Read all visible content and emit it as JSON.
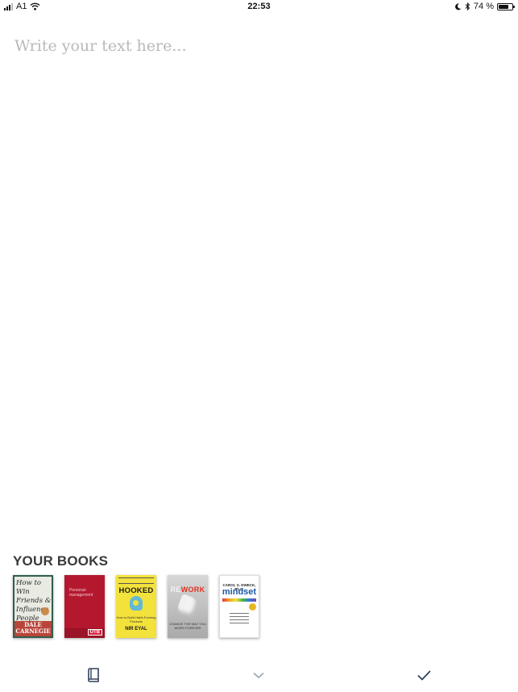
{
  "status_bar": {
    "carrier": "A1",
    "time": "22:53",
    "battery_percent": "74 %",
    "battery_level": 0.74,
    "icons": [
      "signal-icon",
      "wifi-icon",
      "moon-icon",
      "bluetooth-icon",
      "battery-icon"
    ]
  },
  "editor": {
    "placeholder": "Write your text here...",
    "value": ""
  },
  "books_section": {
    "title": "YOUR BOOKS",
    "books": [
      {
        "title_lines": [
          "How to Win",
          "Friends &",
          "Influence",
          "People"
        ],
        "author": "DALE CARNEGIE",
        "color": "#b9453a"
      },
      {
        "title_lines": [
          "Personal-",
          "management"
        ],
        "publisher_badge": "UTB",
        "color": "#b3182f"
      },
      {
        "title": "HOOKED",
        "subtitle": "How to Build Habit-Forming Products",
        "author": "NIR EYAL",
        "color": "#f3e23b"
      },
      {
        "title_prefix": "RE",
        "title_suffix": "WORK",
        "subtitle": "CHANGE THE WAY YOU WORK FOREVER",
        "color": "#a9a9a9"
      },
      {
        "author": "CAROL S. DWECK, Ph.D.",
        "title": "mindset",
        "color": "#1d57a6"
      }
    ]
  },
  "toolbar": {
    "left_icon": "book-icon",
    "center_icon": "chevron-down-icon",
    "right_icon": "checkmark-icon",
    "icon_color": "#33415c"
  }
}
